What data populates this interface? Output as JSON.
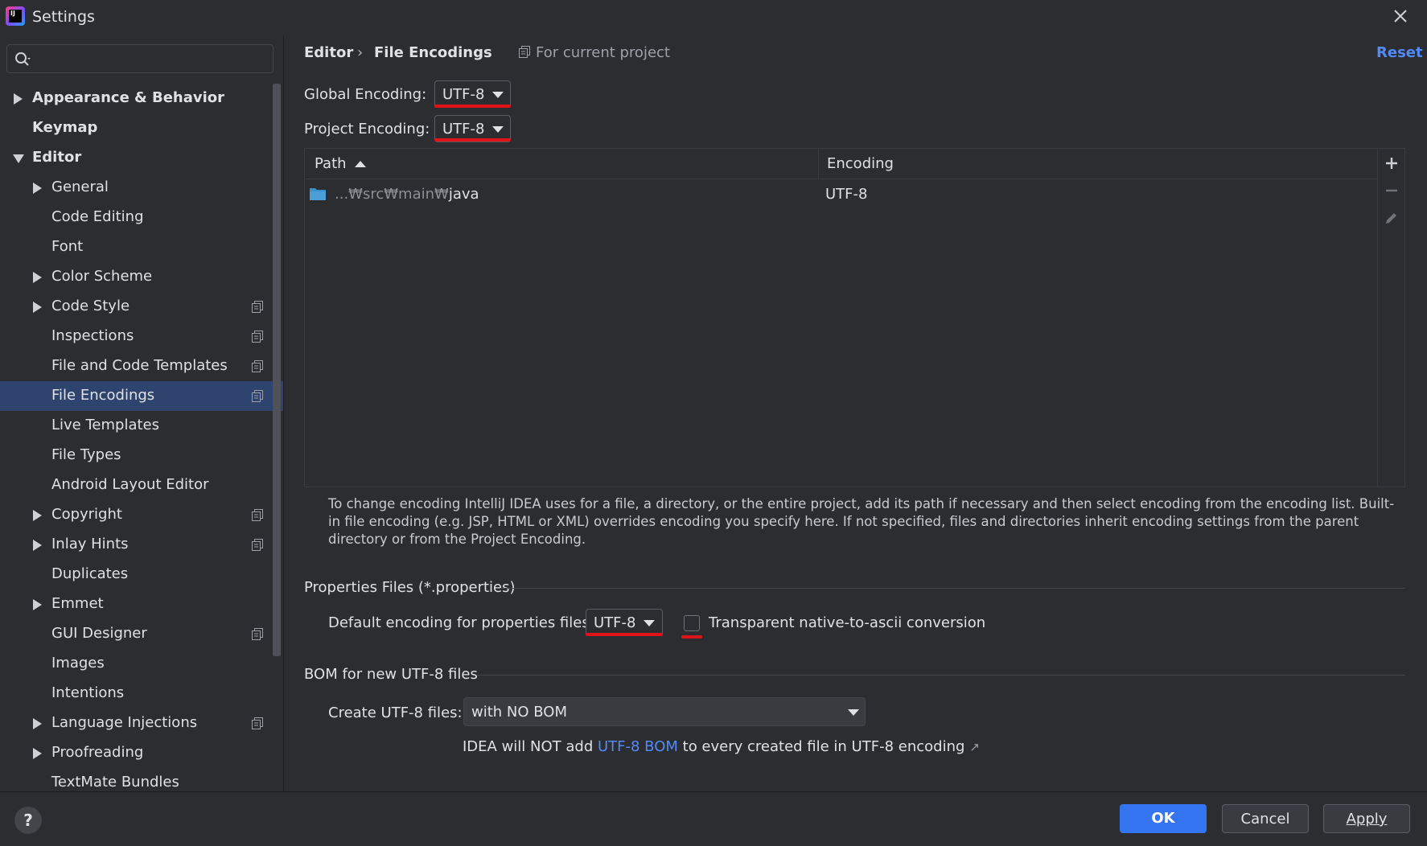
{
  "window": {
    "title": "Settings"
  },
  "search": {
    "placeholder": "",
    "value": ""
  },
  "sidebar": {
    "items": [
      {
        "label": "Appearance & Behavior",
        "bold": true,
        "arrow": "right",
        "indent": 0,
        "proj": false
      },
      {
        "label": "Keymap",
        "bold": true,
        "arrow": "",
        "indent": 0,
        "proj": false
      },
      {
        "label": "Editor",
        "bold": true,
        "arrow": "down",
        "indent": 0,
        "proj": false
      },
      {
        "label": "General",
        "bold": false,
        "arrow": "right",
        "indent": 1,
        "proj": false
      },
      {
        "label": "Code Editing",
        "bold": false,
        "arrow": "",
        "indent": 1,
        "proj": false
      },
      {
        "label": "Font",
        "bold": false,
        "arrow": "",
        "indent": 1,
        "proj": false
      },
      {
        "label": "Color Scheme",
        "bold": false,
        "arrow": "right",
        "indent": 1,
        "proj": false
      },
      {
        "label": "Code Style",
        "bold": false,
        "arrow": "right",
        "indent": 1,
        "proj": true
      },
      {
        "label": "Inspections",
        "bold": false,
        "arrow": "",
        "indent": 1,
        "proj": true
      },
      {
        "label": "File and Code Templates",
        "bold": false,
        "arrow": "",
        "indent": 1,
        "proj": true
      },
      {
        "label": "File Encodings",
        "bold": false,
        "arrow": "",
        "indent": 1,
        "proj": true,
        "selected": true
      },
      {
        "label": "Live Templates",
        "bold": false,
        "arrow": "",
        "indent": 1,
        "proj": false
      },
      {
        "label": "File Types",
        "bold": false,
        "arrow": "",
        "indent": 1,
        "proj": false
      },
      {
        "label": "Android Layout Editor",
        "bold": false,
        "arrow": "",
        "indent": 1,
        "proj": false
      },
      {
        "label": "Copyright",
        "bold": false,
        "arrow": "right",
        "indent": 1,
        "proj": true
      },
      {
        "label": "Inlay Hints",
        "bold": false,
        "arrow": "right",
        "indent": 1,
        "proj": true
      },
      {
        "label": "Duplicates",
        "bold": false,
        "arrow": "",
        "indent": 1,
        "proj": false
      },
      {
        "label": "Emmet",
        "bold": false,
        "arrow": "right",
        "indent": 1,
        "proj": false
      },
      {
        "label": "GUI Designer",
        "bold": false,
        "arrow": "",
        "indent": 1,
        "proj": true
      },
      {
        "label": "Images",
        "bold": false,
        "arrow": "",
        "indent": 1,
        "proj": false
      },
      {
        "label": "Intentions",
        "bold": false,
        "arrow": "",
        "indent": 1,
        "proj": false
      },
      {
        "label": "Language Injections",
        "bold": false,
        "arrow": "right",
        "indent": 1,
        "proj": true
      },
      {
        "label": "Proofreading",
        "bold": false,
        "arrow": "right",
        "indent": 1,
        "proj": false
      },
      {
        "label": "TextMate Bundles",
        "bold": false,
        "arrow": "",
        "indent": 1,
        "proj": false
      }
    ]
  },
  "header": {
    "crumb_parent": "Editor",
    "crumb_separator": "›",
    "crumb_current": "File Encodings",
    "scope": "For current project",
    "reset": "Reset"
  },
  "encodings": {
    "global_label": "Global Encoding:",
    "global_value": "UTF-8",
    "project_label": "Project Encoding:",
    "project_value": "UTF-8"
  },
  "table": {
    "columns": [
      "Path",
      "Encoding"
    ],
    "rows": [
      {
        "path_prefix": "...₩src₩main₩",
        "path_tail": "java",
        "encoding": "UTF-8"
      }
    ]
  },
  "help_text": "To change encoding IntelliJ IDEA uses for a file, a directory, or the entire project, add its path if necessary and then select encoding from the encoding list. Built-in file encoding (e.g. JSP, HTML or XML) overrides encoding you specify here. If not specified, files and directories inherit encoding settings from the parent directory or from the Project Encoding.",
  "properties": {
    "section_title": "Properties Files (*.properties)",
    "default_label": "Default encoding for properties files:",
    "default_value": "UTF-8",
    "transparent_label": "Transparent native-to-ascii conversion",
    "transparent_checked": false
  },
  "bom": {
    "section_title": "BOM for new UTF-8 files",
    "create_label": "Create UTF-8 files:",
    "create_value": "with NO BOM",
    "note_before": "IDEA will NOT add ",
    "note_link": "UTF-8 BOM",
    "note_after": " to every created file in UTF-8 encoding",
    "note_arrow": "↗"
  },
  "footer": {
    "help": "?",
    "ok": "OK",
    "cancel": "Cancel",
    "apply": "Apply"
  },
  "colors": {
    "background": "#2b2d30",
    "selection": "#2e436e",
    "accent": "#3574f0",
    "link": "#548af7",
    "highlight_red": "#e0131b"
  }
}
